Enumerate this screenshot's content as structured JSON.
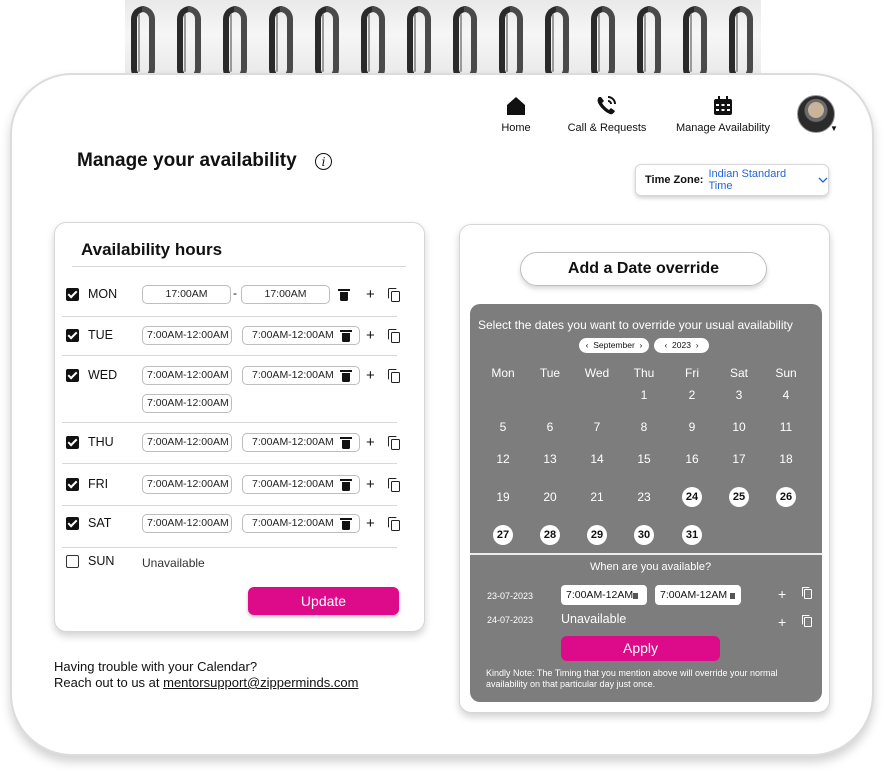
{
  "nav": {
    "home": "Home",
    "calls": "Call & Requests",
    "availability": "Manage Availability"
  },
  "page": {
    "title": "Manage your availability",
    "info_icon": "i"
  },
  "timezone": {
    "label": "Time Zone:",
    "value": "Indian Standard Time"
  },
  "availability": {
    "title": "Availability hours",
    "days": [
      {
        "day": "MON",
        "checked": true,
        "slots": [
          "17:00AM",
          "17:00AM"
        ]
      },
      {
        "day": "TUE",
        "checked": true,
        "slots": [
          "7:00AM-12:00AM",
          "7:00AM-12:00AM"
        ]
      },
      {
        "day": "WED",
        "checked": true,
        "slots": [
          "7:00AM-12:00AM",
          "7:00AM-12:00AM",
          "7:00AM-12:00AM"
        ]
      },
      {
        "day": "THU",
        "checked": true,
        "slots": [
          "7:00AM-12:00AM",
          "7:00AM-12:00AM"
        ]
      },
      {
        "day": "FRI",
        "checked": true,
        "slots": [
          "7:00AM-12:00AM",
          "7:00AM-12:00AM"
        ]
      },
      {
        "day": "SAT",
        "checked": true,
        "slots": [
          "7:00AM-12:00AM",
          "7:00AM-12:00AM"
        ]
      },
      {
        "day": "SUN",
        "checked": false,
        "slots": []
      }
    ],
    "dash": "-",
    "unavailable": "Unavailable",
    "update_button": "Update"
  },
  "help": {
    "line1": "Having trouble with your Calendar?",
    "line2_prefix": "Reach out to us at ",
    "email": "mentorsupport@zipperminds.com"
  },
  "override": {
    "button": "Add a Date override",
    "instruction": "Select the dates you want to override your usual availability",
    "month": "September",
    "year": "2023",
    "weekdays": [
      "Mon",
      "Tue",
      "Wed",
      "Thu",
      "Fri",
      "Sat",
      "Sun"
    ],
    "weeks": [
      [
        "",
        "",
        "",
        "1",
        "2",
        "3",
        "4"
      ],
      [
        "5",
        "6",
        "7",
        "8",
        "9",
        "10",
        "11"
      ],
      [
        "12",
        "13",
        "14",
        "15",
        "16",
        "17",
        "18"
      ],
      [
        "19",
        "20",
        "21",
        "23",
        "24",
        "25",
        "26"
      ],
      [
        "27",
        "28",
        "29",
        "30",
        "31",
        "",
        ""
      ]
    ],
    "selected_dates": [
      "24",
      "25",
      "26",
      "27",
      "28",
      "29",
      "30",
      "31"
    ],
    "question": "When are you available?",
    "rows": [
      {
        "date": "23-07-2023",
        "slots": [
          "7:00AM-12AM",
          "7:00AM-12AM"
        ]
      },
      {
        "date": "24-07-2023",
        "status": "Unavailable"
      }
    ],
    "apply_button": "Apply",
    "note": "Kindly Note: The Timing that you mention above will override your normal availability on that particular day just once."
  }
}
